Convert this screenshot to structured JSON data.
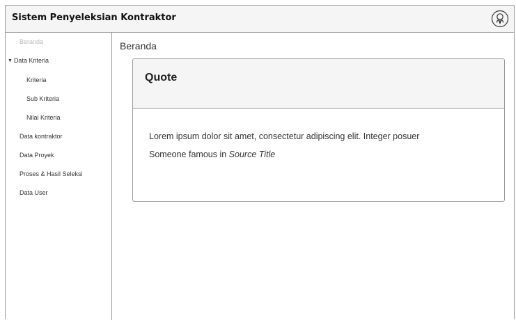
{
  "header": {
    "title": "Sistem Penyeleksian Kontraktor",
    "user_icon": "user-circle-icon"
  },
  "sidebar": {
    "items": [
      {
        "label": "Beranda",
        "state": "disabled"
      },
      {
        "label": "Data Kriteria",
        "state": "expanded"
      },
      {
        "label": "Kriteria"
      },
      {
        "label": "Sub Kriteria"
      },
      {
        "label": "Nilai Kriteria"
      },
      {
        "label": "Data kontraktor"
      },
      {
        "label": "Data Proyek"
      },
      {
        "label": "Proses & Hasil Seleksi"
      },
      {
        "label": "Data User"
      }
    ],
    "caret_icon": "caret-down-icon"
  },
  "main": {
    "page_title": "Beranda",
    "card": {
      "title": "Quote",
      "text": "Lorem ipsum dolor sit amet, consectetur adipiscing elit. Integer posuer",
      "source_prefix": "Someone famous in",
      "source_title": "Source Title"
    }
  }
}
